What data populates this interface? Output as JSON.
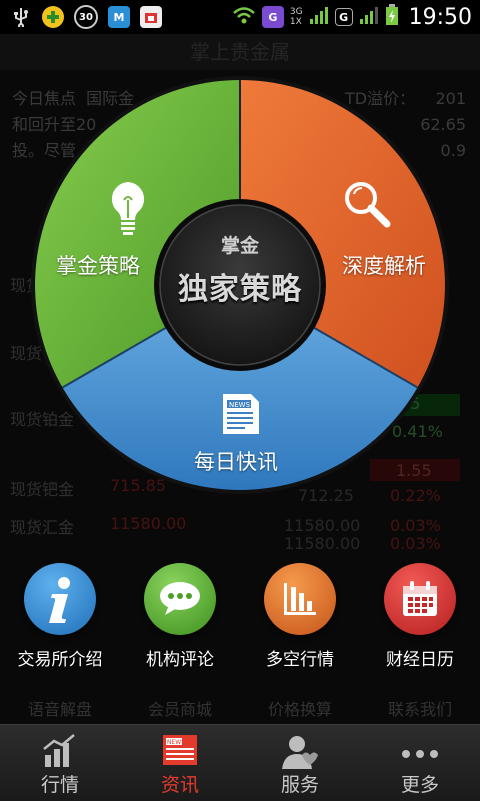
{
  "status_bar": {
    "time": "19:50",
    "badge_30": "30",
    "signal_top": "3G",
    "signal_bottom": "1X",
    "g_badge": "G"
  },
  "background": {
    "header_title": "掌上贵金属",
    "news_left": "今日焦点  国际金\n和回升至20\n投。尽管",
    "news_right": "TD溢价：    201\n62.65\n0.9",
    "rows": [
      {
        "label": "现货",
        "value": ""
      },
      {
        "label": "现货",
        "value": ""
      },
      {
        "label": "现货铂金",
        "value": "75"
      },
      {
        "label": "现货钯金",
        "value": "715.85"
      },
      {
        "label": "现货汇金",
        "value": "11580.00"
      }
    ],
    "right_values": [
      "0.41%",
      "1.55",
      "712.25",
      "0.22%",
      "11580.00",
      "0.03%",
      "11580.00",
      "0.03%"
    ],
    "tools": [
      "语音解盘",
      "会员商城",
      "价格换算",
      "联系我们"
    ]
  },
  "wheel": {
    "center_line1": "掌金",
    "center_line2": "独家策略",
    "segments": [
      {
        "label": "掌金策略",
        "icon": "lightbulb-icon",
        "color": "#6fb83e"
      },
      {
        "label": "深度解析",
        "icon": "magnifier-icon",
        "color": "#e3642a"
      },
      {
        "label": "每日快讯",
        "icon": "news-icon",
        "color": "#4b93d1"
      }
    ]
  },
  "round_buttons": [
    {
      "label": "交易所介绍",
      "icon": "info-icon",
      "color": "#2d86d1"
    },
    {
      "label": "机构评论",
      "icon": "chat-bubble-icon",
      "color": "#58b32c"
    },
    {
      "label": "多空行情",
      "icon": "bar-chart-icon",
      "color": "#e46c1e"
    },
    {
      "label": "财经日历",
      "icon": "calendar-icon",
      "color": "#d6302e"
    }
  ],
  "tabs": [
    {
      "label": "行情",
      "icon": "market-chart-icon",
      "active": false
    },
    {
      "label": "资讯",
      "icon": "news-tab-icon",
      "active": true
    },
    {
      "label": "服务",
      "icon": "service-person-icon",
      "active": false
    },
    {
      "label": "更多",
      "icon": "more-dots-icon",
      "active": false
    }
  ],
  "colors": {
    "accent_red": "#e23b2e",
    "tab_bg": "#262626"
  }
}
